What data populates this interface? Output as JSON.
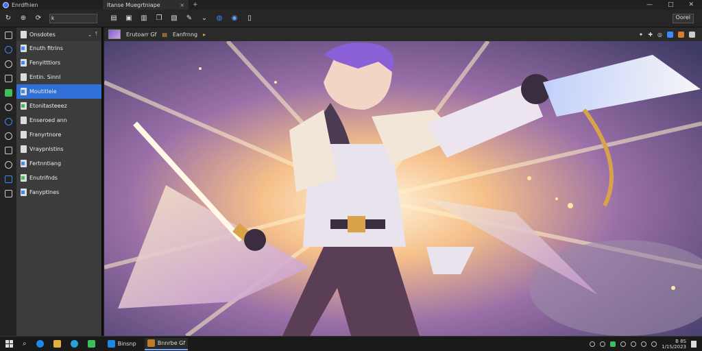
{
  "window": {
    "app_title": "Enrdfhien",
    "tab_title": "Itanse Muegrtniape",
    "tab_close": "×",
    "tab_add": "+",
    "controls": [
      "—",
      "□",
      "✕"
    ]
  },
  "toolbar": {
    "address_value": "k",
    "ok_label": "Oorel"
  },
  "sidebar": {
    "header": "Onsdotes",
    "items": [
      {
        "label": "Enuth fitrins",
        "icon": "blue"
      },
      {
        "label": "Fenyitttiors",
        "icon": "blue"
      },
      {
        "label": "Entin. Sinnl",
        "icon": "plain"
      },
      {
        "label": "Moutitleie",
        "icon": "blue",
        "active": true
      },
      {
        "label": "Etonitasteeez",
        "icon": "green"
      },
      {
        "label": "Enseroed ann",
        "icon": "plain"
      },
      {
        "label": "Franyrtnore",
        "icon": "plain"
      },
      {
        "label": "Vraypnlstins",
        "icon": "plain"
      },
      {
        "label": "Fertnntiang",
        "icon": "blue"
      },
      {
        "label": "Enutrifnds",
        "icon": "green"
      },
      {
        "label": "Fanyptlnes",
        "icon": "blue"
      }
    ]
  },
  "viewer": {
    "doc1": "Erutoarr Gf",
    "doc2": "Eanfrnng"
  },
  "taskbar": {
    "apps": [
      {
        "label": "Binsnp",
        "color": "#1e88e5",
        "active": false
      },
      {
        "label": "Bnnrbe Gf",
        "color": "#c07a2a",
        "active": true
      }
    ],
    "clock_time": "B 8S",
    "clock_date": "1/1S/2023"
  },
  "colors": {
    "accent": "#2f6fd6",
    "green": "#3fbf5a",
    "orange": "#e07b2a"
  }
}
